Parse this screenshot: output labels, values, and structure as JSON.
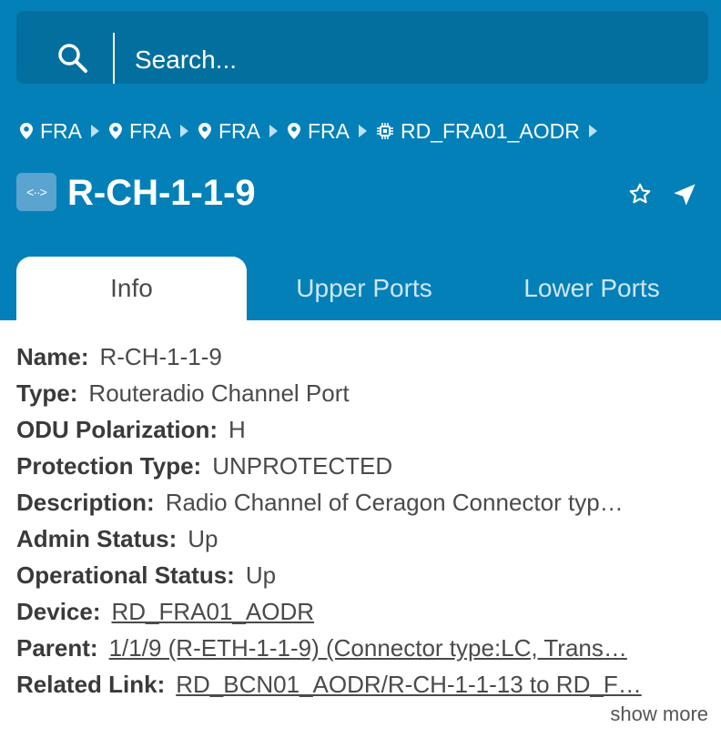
{
  "colors": {
    "header_bg": "#0480b9",
    "search_bg": "#036f9f",
    "tab_inactive_text": "#cfe6f3"
  },
  "search": {
    "placeholder": "Search..."
  },
  "breadcrumb": [
    {
      "icon": "location-pin-icon",
      "label": "FRA"
    },
    {
      "icon": "location-pin-icon",
      "label": "FRA"
    },
    {
      "icon": "location-pin-icon",
      "label": "FRA"
    },
    {
      "icon": "location-pin-icon",
      "label": "FRA"
    },
    {
      "icon": "device-chip-icon",
      "label": "RD_FRA01_AODR"
    }
  ],
  "header": {
    "type_badge": "<··>",
    "title": "R-CH-1-1-9"
  },
  "tabs": [
    {
      "label": "Info"
    },
    {
      "label": "Upper Ports"
    },
    {
      "label": "Lower Ports"
    }
  ],
  "info": {
    "rows": [
      {
        "key": "Name:",
        "value": "R-CH-1-1-9"
      },
      {
        "key": "Type:",
        "value": "Routeradio Channel Port"
      },
      {
        "key": "ODU Polarization:",
        "value": "H"
      },
      {
        "key": "Protection Type:",
        "value": "UNPROTECTED"
      },
      {
        "key": "Description:",
        "value": "Radio Channel of Ceragon Connector typ…"
      },
      {
        "key": "Admin Status:",
        "value": "Up"
      },
      {
        "key": "Operational Status:",
        "value": "Up"
      },
      {
        "key": "Device:",
        "value": "RD_FRA01_AODR"
      },
      {
        "key": "Parent:",
        "value": "1/1/9 (R-ETH-1-1-9) (Connector type:LC, Trans…"
      },
      {
        "key": "Related Link:",
        "value": "RD_BCN01_AODR/R-CH-1-1-13 to RD_F…"
      }
    ],
    "show_more": "show more"
  }
}
